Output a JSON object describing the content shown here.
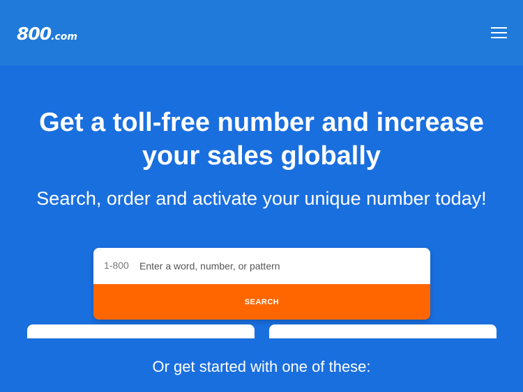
{
  "header": {
    "logo_main": "800",
    "logo_suffix": ".com",
    "background_color": "#1f7ad9",
    "menu_icon": "hamburger-menu-icon"
  },
  "hero": {
    "background_color": "#1a6fdf",
    "headline_line1": "Get a toll-free number and increase",
    "headline_line2": "your sales globally",
    "subheadline": "Search, order and activate your unique number today!"
  },
  "search": {
    "prefix": "1-800",
    "placeholder": "Enter a word, number, or pattern",
    "value": "",
    "button_label": "SEARCH",
    "button_color": "#ff6600"
  },
  "options": {
    "heading": "Or get started with one of these:"
  }
}
